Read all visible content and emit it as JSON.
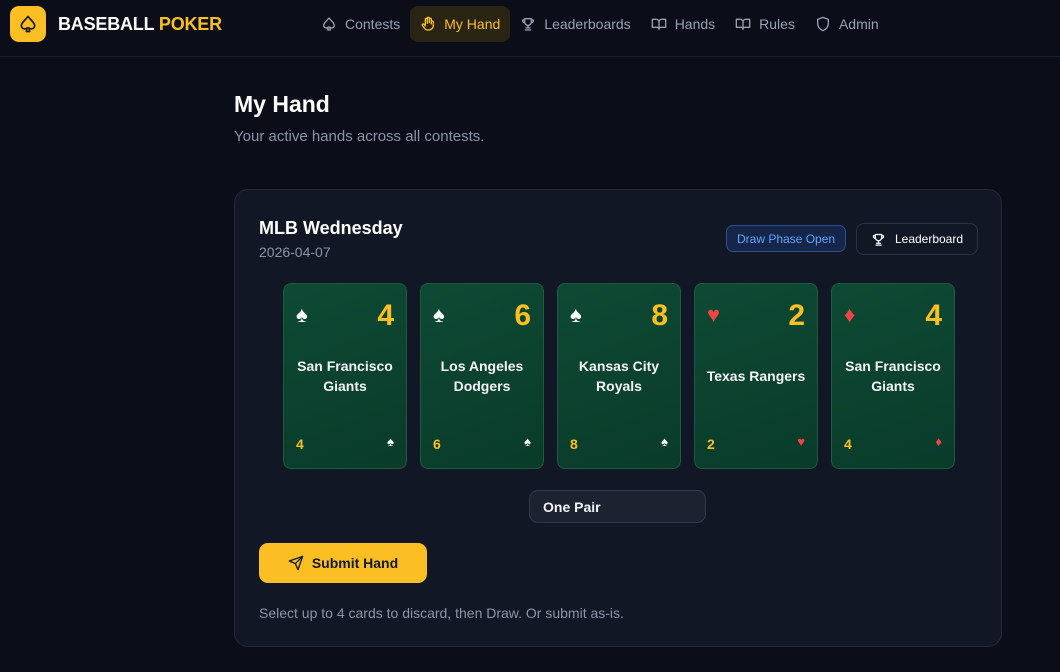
{
  "brand": {
    "name_part1": "BASEBALL",
    "name_part2": "POKER",
    "logo_icon": "spade-icon",
    "accent": "#fbbf24"
  },
  "nav": {
    "items": [
      {
        "label": "Contests",
        "icon": "spade-outline-icon",
        "active": false
      },
      {
        "label": "My Hand",
        "icon": "hand-icon",
        "active": true
      },
      {
        "label": "Leaderboards",
        "icon": "trophy-icon",
        "active": false
      },
      {
        "label": "Hands",
        "icon": "book-icon",
        "active": false
      },
      {
        "label": "Rules",
        "icon": "book-icon",
        "active": false
      },
      {
        "label": "Admin",
        "icon": "shield-icon",
        "active": false
      }
    ]
  },
  "page": {
    "title": "My Hand",
    "subtitle": "Your active hands across all contests."
  },
  "contest": {
    "name": "MLB Wednesday",
    "date": "2026-04-07",
    "phase_badge": "Draw Phase Open",
    "leaderboard_label": "Leaderboard",
    "cards": [
      {
        "rank": "4",
        "suit": "spade",
        "team": "San Francisco Giants"
      },
      {
        "rank": "6",
        "suit": "spade",
        "team": "Los Angeles Dodgers"
      },
      {
        "rank": "8",
        "suit": "spade",
        "team": "Kansas City Royals"
      },
      {
        "rank": "2",
        "suit": "heart",
        "team": "Texas Rangers"
      },
      {
        "rank": "4",
        "suit": "diamond",
        "team": "San Francisco Giants"
      }
    ],
    "hand_rank": "One Pair",
    "submit_label": "Submit Hand",
    "helper_text": "Select up to 4 cards to discard, then Draw. Or submit as-is."
  },
  "colors": {
    "card_green": "#0d4a34",
    "red_suit": "#ef4444",
    "badge_blue": "#60a5fa"
  }
}
